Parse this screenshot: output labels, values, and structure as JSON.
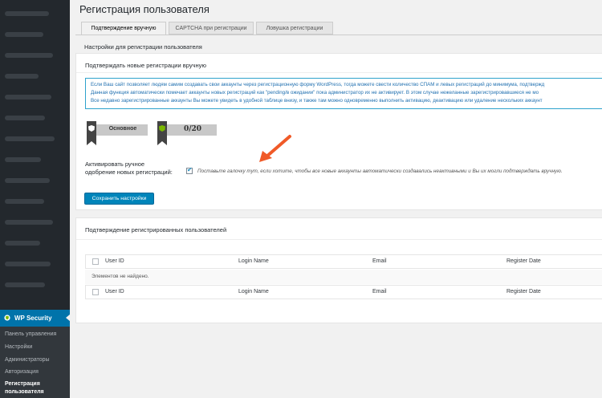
{
  "sidebar": {
    "active": {
      "label": "WP Security",
      "icon": "shield-icon"
    },
    "submenu": [
      {
        "label": "Панель управления"
      },
      {
        "label": "Настройки"
      },
      {
        "label": "Администраторы"
      },
      {
        "label": "Авторизация"
      },
      {
        "label": "Регистрация пользователя"
      }
    ]
  },
  "page": {
    "title": "Регистрация пользователя"
  },
  "tabs": [
    {
      "label": "Подтверждение вручную"
    },
    {
      "label": "CAPTCHA при регистрации"
    },
    {
      "label": "Ловушка регистрации"
    }
  ],
  "section_title": "Настройки для регистрации пользователя",
  "panel1": {
    "heading": "Подтверждать новые регистрации вручную",
    "info_lines": [
      "Если Ваш сайт позволяет людям самим создавать свои аккаунты через регистрационную форму WordPress, тогда можете свести количество СПАМ и левых регистраций до минимума, подтвержд",
      "Данная функция автоматически помечает аккаунты новых регистраций как \"pending/в ожидании\" пока администратор их не активирует. В этом случае нежеланные зарегистрировавшиеся не мо",
      "Все недавно зарегистрированные аккаунты Вы можете увидеть в удобной таблице внизу, и также там можно одновременно выполнить активацию, деактивацию или удаление нескольких аккаунт"
    ],
    "badge_basic": "Основное",
    "badge_score": "0/20",
    "field_label": "Активировать ручное одобрение новых регистраций:",
    "checkbox_checked": true,
    "field_desc": "Поставьте галочку тут, если хотите, чтобы все новые аккаунты автоматически создавались неактивными и Вы их могли подтверждать вручную.",
    "save_button": "Сохранить настройки"
  },
  "panel2": {
    "heading": "Подтверждение регистрированных пользователей",
    "columns": [
      "User ID",
      "Login Name",
      "Email",
      "Register Date"
    ],
    "empty_text": "Элементов не найдено."
  },
  "colors": {
    "accent": "#0073aa",
    "button": "#0085ba",
    "arrow": "#f05a28"
  }
}
